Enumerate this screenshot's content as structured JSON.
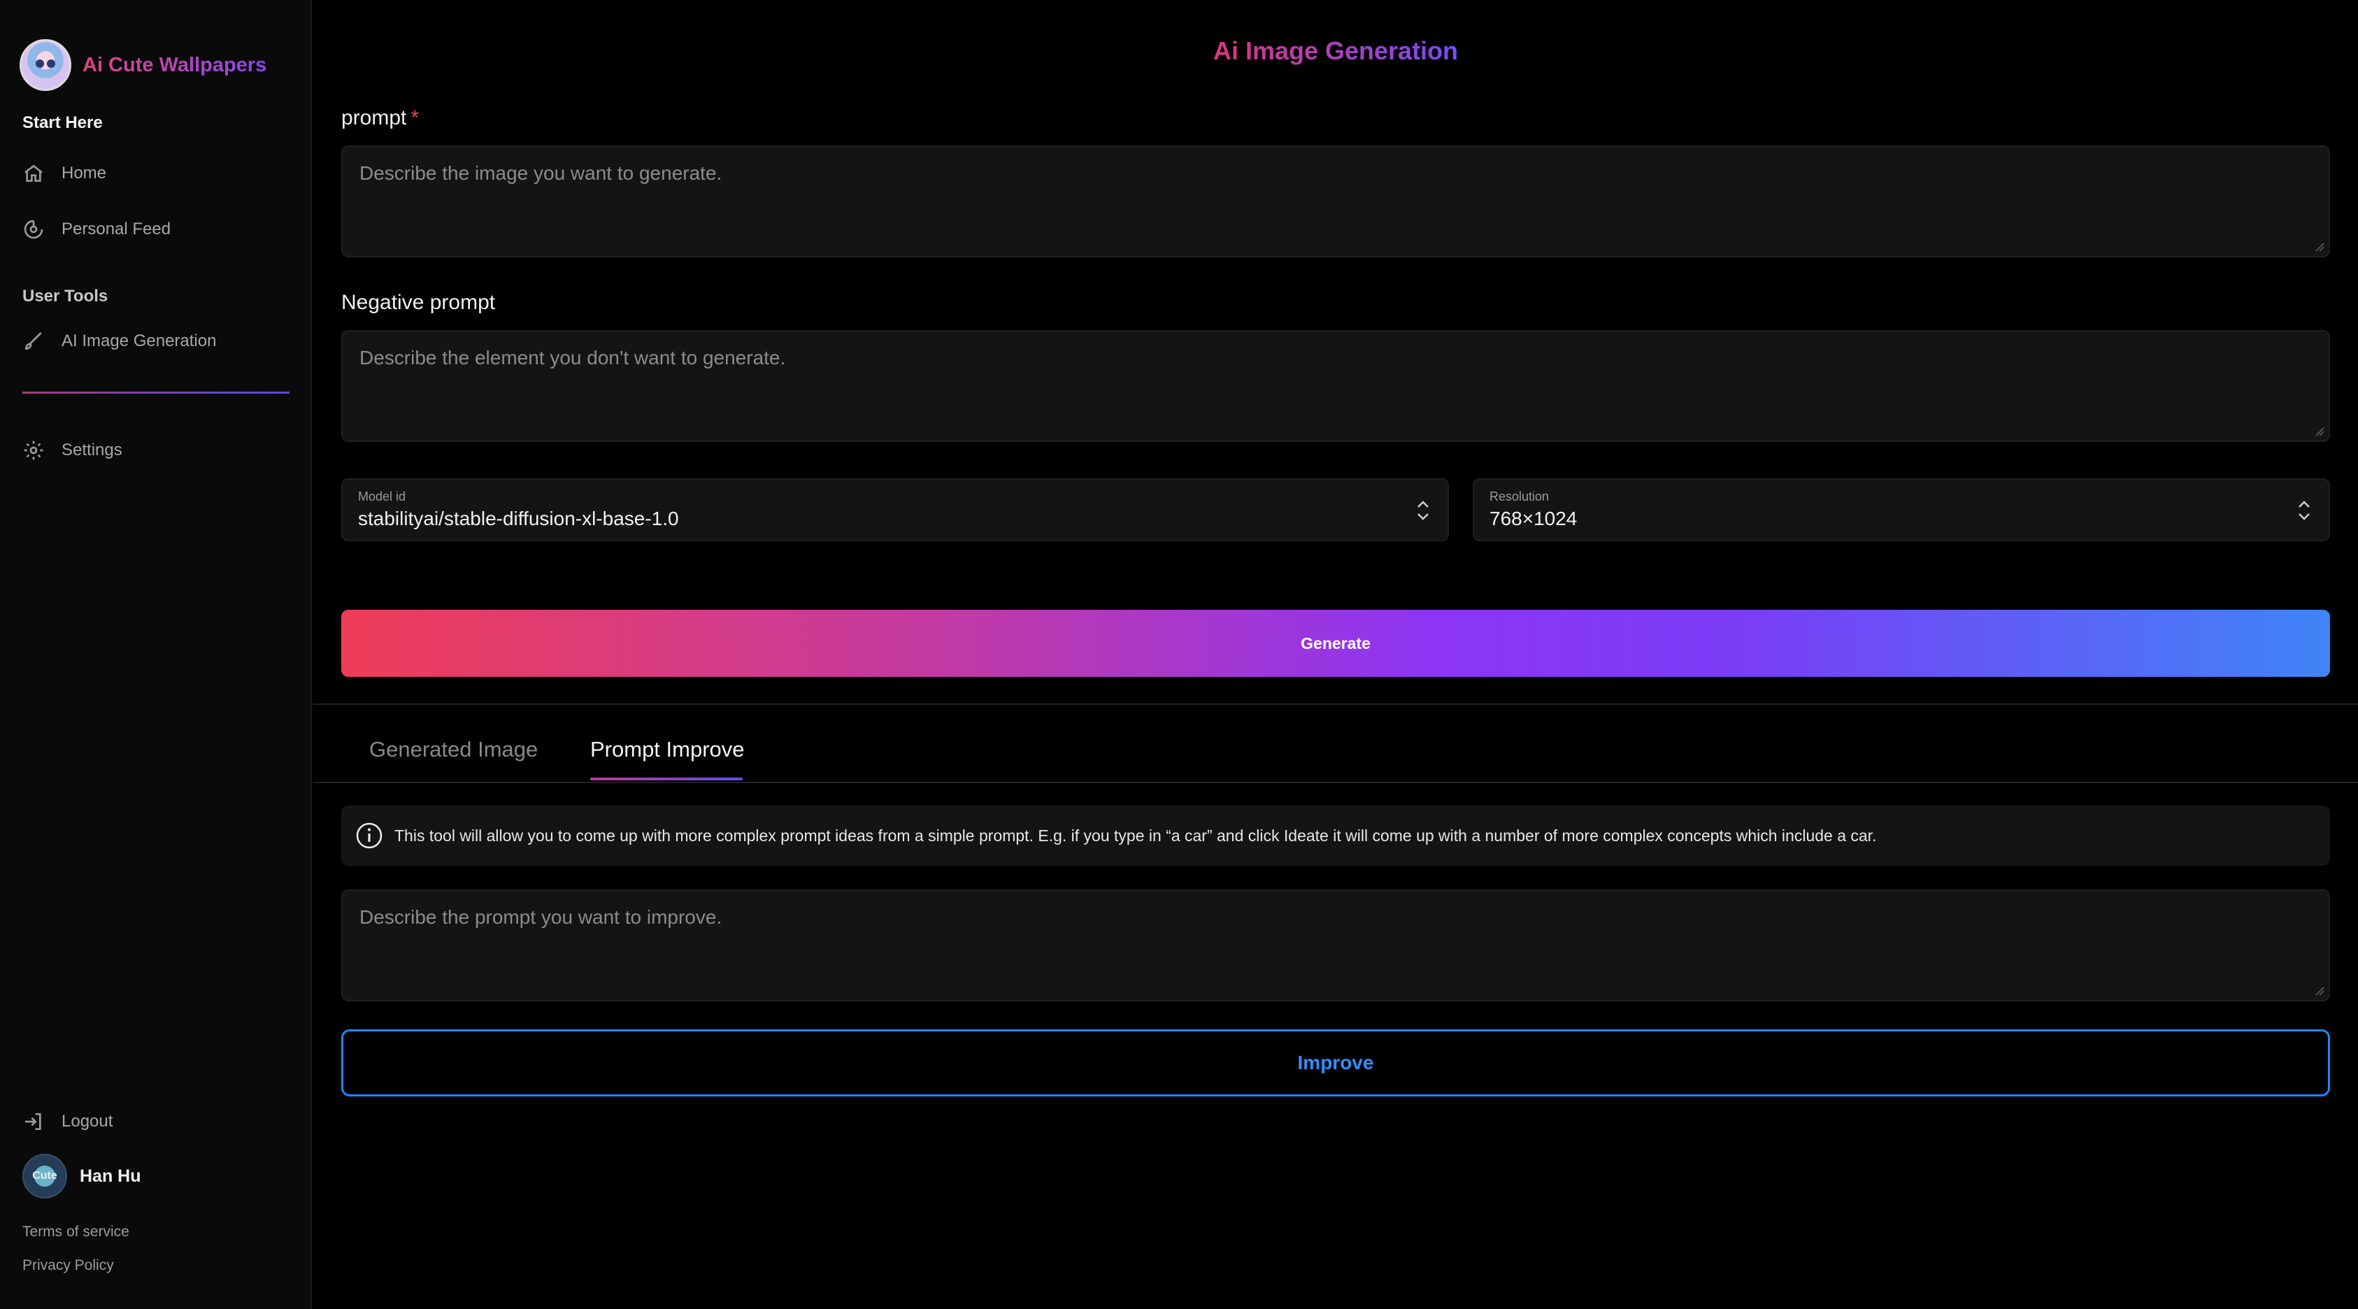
{
  "brand": {
    "name": "Ai Cute Wallpapers",
    "logo_icon": "robot-logo-icon"
  },
  "sidebar": {
    "start_label": "Start Here",
    "items": [
      {
        "label": "Home",
        "icon": "home-icon"
      },
      {
        "label": "Personal Feed",
        "icon": "feed-icon"
      }
    ],
    "tools_label": "User Tools",
    "tools": [
      {
        "label": "AI Image Generation",
        "icon": "brush-icon"
      }
    ],
    "settings": {
      "label": "Settings",
      "icon": "gear-icon"
    },
    "logout": {
      "label": "Logout",
      "icon": "logout-icon"
    },
    "user": {
      "name": "Han Hu",
      "avatar_text": "Cute"
    },
    "footer": {
      "terms": "Terms of service",
      "privacy": "Privacy Policy"
    }
  },
  "main": {
    "title": "Ai Image Generation",
    "prompt": {
      "label": "prompt",
      "required_mark": "*",
      "placeholder": "Describe the image you want to generate."
    },
    "negative": {
      "label": "Negative prompt",
      "placeholder": "Describe the element you don't want to generate."
    },
    "model": {
      "caption": "Model id",
      "value": "stabilityai/stable-diffusion-xl-base-1.0"
    },
    "resolution": {
      "caption": "Resolution",
      "value": "768×1024"
    },
    "generate_label": "Generate",
    "tabs": [
      {
        "label": "Generated Image",
        "active": false
      },
      {
        "label": "Prompt Improve",
        "active": true
      }
    ],
    "info_text": "This tool will allow you to come up with more complex prompt ideas from a simple prompt. E.g. if you type in “a car” and click Ideate it will come up with a number of more complex concepts which include a car.",
    "improve_placeholder": "Describe the prompt you want to improve.",
    "improve_label": "Improve"
  },
  "colors": {
    "accent_pink": "#d8367c",
    "accent_purple": "#7b4bf7",
    "accent_blue": "#1f86ff",
    "required_red": "#e5484d"
  }
}
